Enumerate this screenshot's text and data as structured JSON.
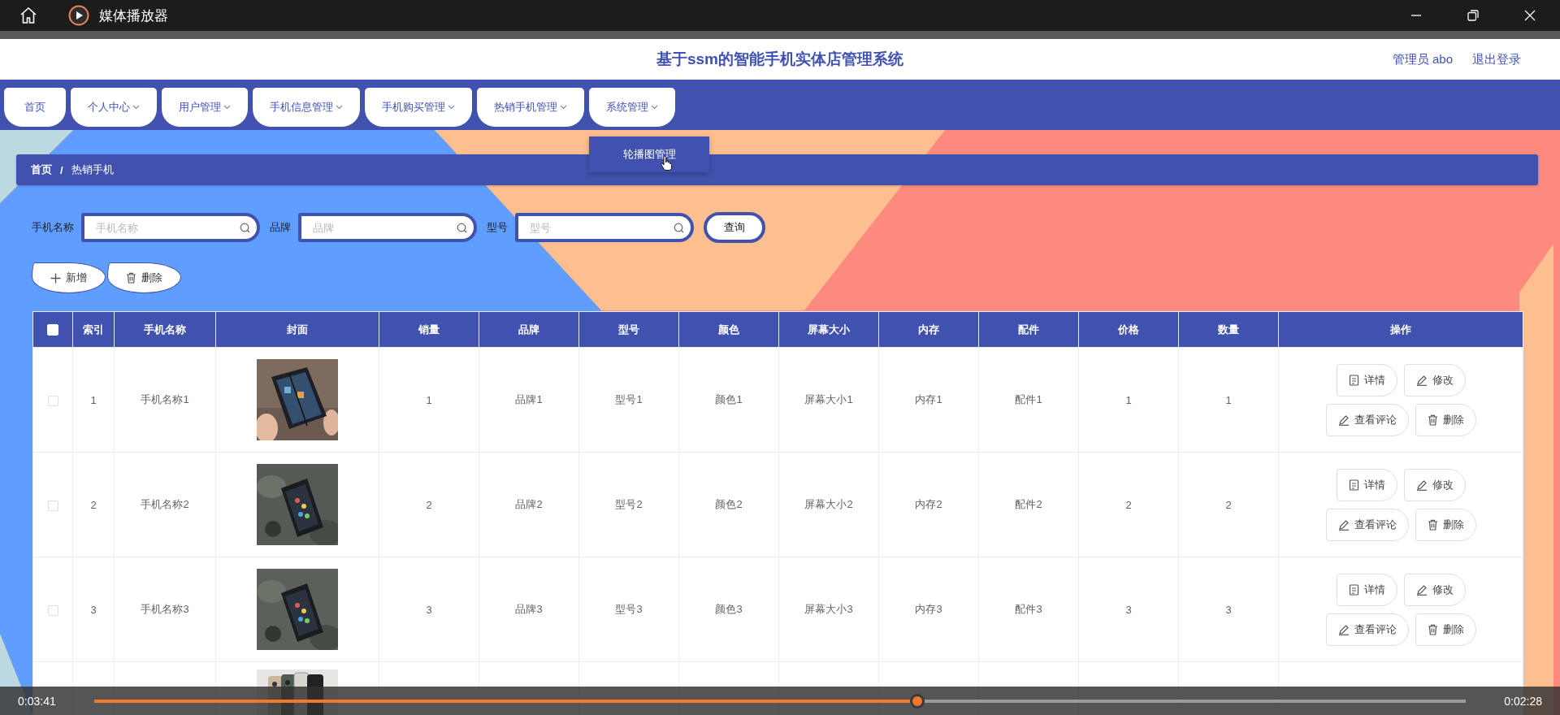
{
  "player": {
    "title": "媒体播放器",
    "elapsed": "0:03:41",
    "remaining": "0:02:28",
    "level": 0.6
  },
  "site": {
    "title": "基于ssm的智能手机实体店管理系统",
    "user": "管理员 abo",
    "logout": "退出登录"
  },
  "nav": [
    {
      "label": "首页",
      "dropdown": false
    },
    {
      "label": "个人中心",
      "dropdown": true
    },
    {
      "label": "用户管理",
      "dropdown": true
    },
    {
      "label": "手机信息管理",
      "dropdown": true
    },
    {
      "label": "手机购买管理",
      "dropdown": true
    },
    {
      "label": "热销手机管理",
      "dropdown": true
    },
    {
      "label": "系统管理",
      "dropdown": true,
      "menu": [
        "轮播图管理"
      ]
    }
  ],
  "breadcrumb": {
    "items": [
      "首页",
      "热销手机"
    ],
    "separator": "/"
  },
  "search": [
    {
      "label": "手机名称",
      "placeholder": "手机名称"
    },
    {
      "label": "品牌",
      "placeholder": "品牌"
    },
    {
      "label": "型号",
      "placeholder": "型号"
    }
  ],
  "query_button": "查询",
  "actions": [
    {
      "kind": "add",
      "label": "新增"
    },
    {
      "kind": "delete",
      "label": "删除"
    }
  ],
  "table": {
    "header_checked": false,
    "columns": [
      "索引",
      "手机名称",
      "封面",
      "销量",
      "品牌",
      "型号",
      "颜色",
      "屏幕大小",
      "内存",
      "配件",
      "价格",
      "数量",
      "操作"
    ],
    "rows": [
      {
        "checked": false,
        "cells": [
          "1",
          "手机名称1",
          {
            "kind": "picture"
          },
          "1",
          "品牌1",
          "型号1",
          "颜色1",
          "屏幕大小1",
          "内存1",
          "配件1",
          "1",
          "1"
        ],
        "actions": [
          {
            "kind": "detail",
            "label": "详情"
          },
          {
            "kind": "edit",
            "label": "修改"
          },
          {
            "kind": "comments",
            "label": "查看评论"
          },
          {
            "kind": "delete",
            "label": "删除"
          }
        ]
      },
      {
        "checked": false,
        "cells": [
          "2",
          "手机名称2",
          {
            "kind": "picture"
          },
          "2",
          "品牌2",
          "型号2",
          "颜色2",
          "屏幕大小2",
          "内存2",
          "配件2",
          "2",
          "2"
        ],
        "actions": [
          {
            "kind": "detail",
            "label": "详情"
          },
          {
            "kind": "edit",
            "label": "修改"
          },
          {
            "kind": "comments",
            "label": "查看评论"
          },
          {
            "kind": "delete",
            "label": "删除"
          }
        ]
      },
      {
        "checked": false,
        "cells": [
          "3",
          "手机名称3",
          {
            "kind": "picture"
          },
          "3",
          "品牌3",
          "型号3",
          "颜色3",
          "屏幕大小3",
          "内存3",
          "配件3",
          "3",
          "3"
        ],
        "actions": [
          {
            "kind": "detail",
            "label": "详情"
          },
          {
            "kind": "edit",
            "label": "修改"
          },
          {
            "kind": "comments",
            "label": "查看评论"
          },
          {
            "kind": "delete",
            "label": "删除"
          }
        ]
      },
      {
        "cells": [
          null,
          null,
          {
            "kind": "picture"
          },
          null,
          null,
          null,
          null,
          null,
          null,
          null,
          null,
          null
        ]
      }
    ]
  }
}
